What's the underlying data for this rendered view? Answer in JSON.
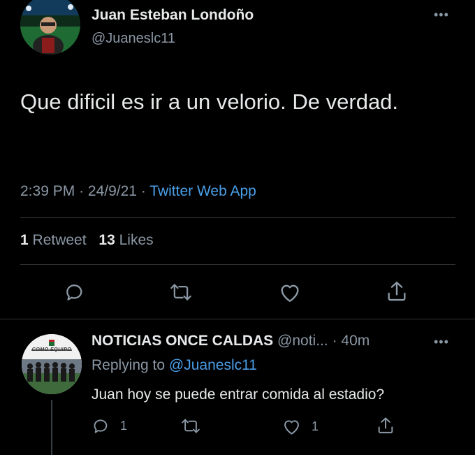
{
  "tweet": {
    "author_name": "Juan Esteban Londoño",
    "author_handle": "@Juaneslc11",
    "text": "Que dificil es ir a un velorio. De verdad.",
    "time": "2:39 PM",
    "separator1": "·",
    "date": "24/9/21",
    "separator2": "·",
    "source": "Twitter Web App",
    "retweets_count": "1",
    "retweets_label": "Retweet",
    "likes_count": "13",
    "likes_label": "Likes",
    "actions": [
      "reply-icon",
      "retweet-icon",
      "like-icon",
      "share-icon"
    ]
  },
  "reply": {
    "author_name": "NOTICIAS ONCE CALDAS",
    "author_handle": "@noti...",
    "separator": "·",
    "time_ago": "40m",
    "replying_prefix": "Replying to",
    "replying_to": "@Juaneslc11",
    "text": "Juan hoy se puede entrar comida al estadio?",
    "reply_count": "1",
    "like_count": "1",
    "avatar_caption": "COMO EQUIPO"
  },
  "colors": {
    "background": "#000000",
    "text": "#e7e9ea",
    "muted": "#8b98a5",
    "link": "#4a9fe8",
    "divider": "#2f3336"
  }
}
